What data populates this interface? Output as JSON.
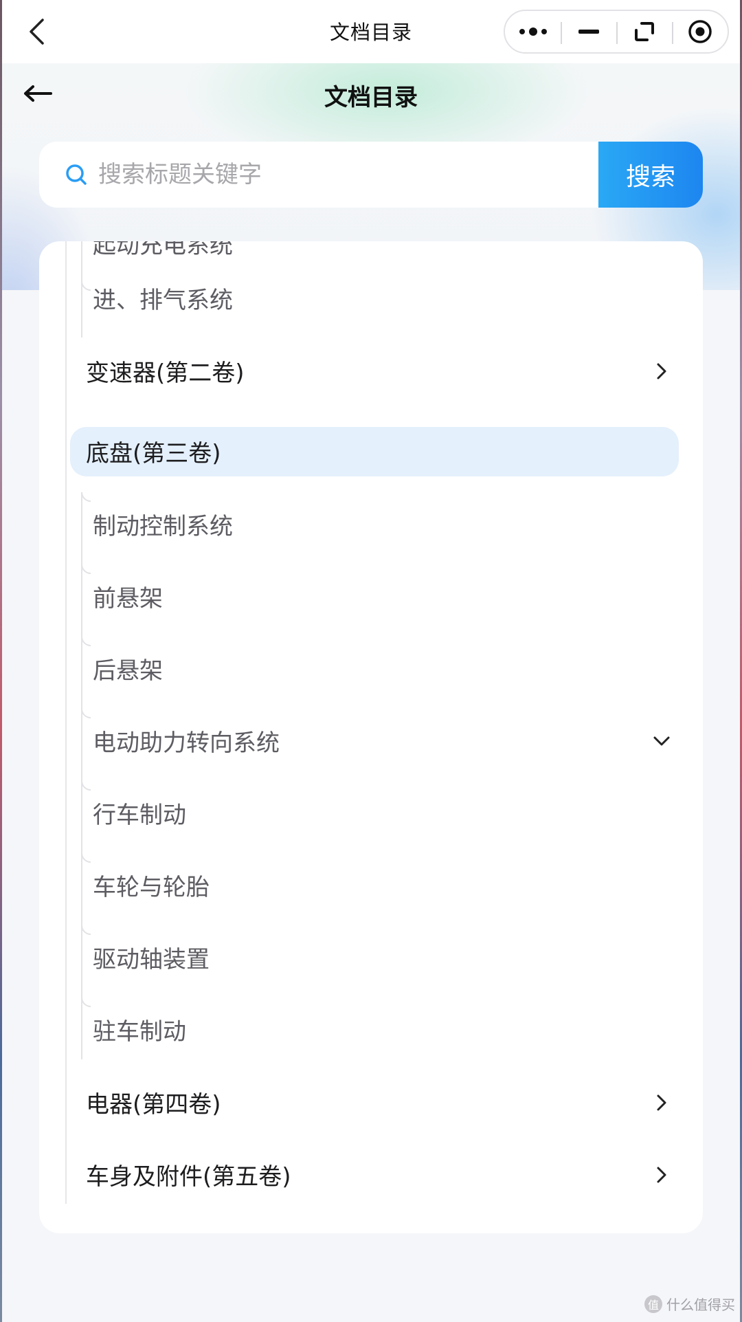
{
  "titlebar": {
    "title": "文档目录",
    "capsule": [
      "more-icon",
      "minimize-icon",
      "restore-icon",
      "record-icon"
    ]
  },
  "header": {
    "title": "文档目录"
  },
  "search": {
    "placeholder": "搜索标题关键字",
    "button_label": "搜索"
  },
  "tree": {
    "partial_top_label": "起动充电系统",
    "items": [
      {
        "label": "进、排气系统",
        "level": 2
      },
      {
        "label": "变速器(第二卷)",
        "level": 1,
        "arrow": "chevron-right-icon"
      },
      {
        "label": "底盘(第三卷)",
        "level": 1,
        "selected": true
      },
      {
        "label": "制动控制系统",
        "level": 2
      },
      {
        "label": "前悬架",
        "level": 2
      },
      {
        "label": "后悬架",
        "level": 2
      },
      {
        "label": "电动助力转向系统",
        "level": 2,
        "arrow": "chevron-down-icon"
      },
      {
        "label": "行车制动",
        "level": 2
      },
      {
        "label": "车轮与轮胎",
        "level": 2
      },
      {
        "label": "驱动轴装置",
        "level": 2
      },
      {
        "label": "驻车制动",
        "level": 2
      },
      {
        "label": "电器(第四卷)",
        "level": 1,
        "arrow": "chevron-right-icon"
      },
      {
        "label": "车身及附件(第五卷)",
        "level": 1,
        "arrow": "chevron-right-icon"
      }
    ]
  },
  "colors": {
    "accent": "#1d86f0",
    "selected_bg": "#e4f0fc"
  },
  "watermark": {
    "text": "什么值得买",
    "logo": "值"
  }
}
